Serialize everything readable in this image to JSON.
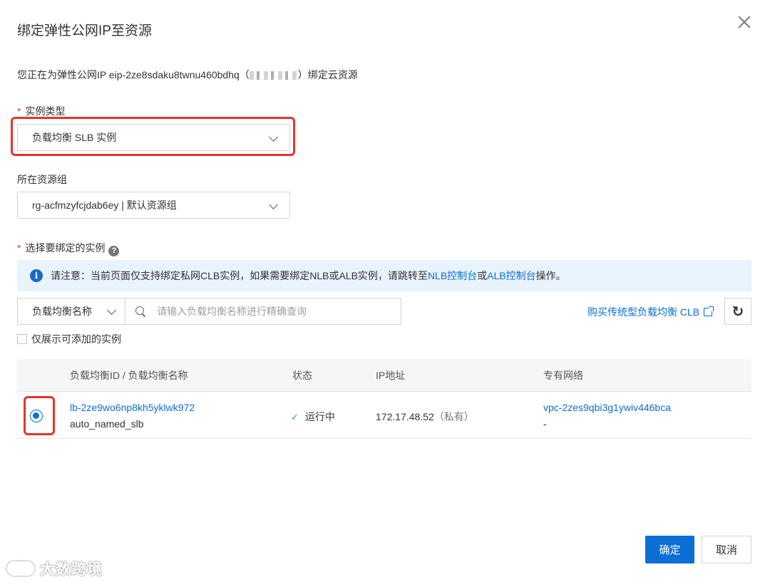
{
  "dialog": {
    "title": "绑定弹性公网IP至资源",
    "intro_prefix": "您正在为弹性公网IP eip-2ze8sdaku8twnu460bdhq（",
    "intro_suffix": "）绑定云资源"
  },
  "instance_type": {
    "label": "实例类型",
    "required_mark": "*",
    "value": "负载均衡 SLB 实例"
  },
  "resource_group": {
    "label": "所在资源组",
    "value": "rg-acfmzyfcjdab6ey | 默认资源组"
  },
  "select_instance": {
    "label": "选择要绑定的实例",
    "required_mark": "*",
    "help_icon": "question-circle-icon"
  },
  "notice": {
    "icon": "info-icon",
    "text_prefix": "请注意：当前页面仅支持绑定私网CLB实例，如果需要绑定NLB或ALB实例，请跳转至",
    "nlb_link": "NLB控制台",
    "middle": "或",
    "alb_link": "ALB控制台",
    "suffix": "操作。"
  },
  "filter": {
    "field_select": "负载均衡名称",
    "search_placeholder": "请输入负载均衡名称进行精确查询",
    "buy_link": "购买传统型负载均衡 CLB",
    "only_addable_label": "仅展示可添加的实例"
  },
  "table": {
    "columns": [
      "负载均衡ID / 负载均衡名称",
      "状态",
      "IP地址",
      "专有网络"
    ],
    "rows": [
      {
        "id": "lb-2ze9wo6np8kh5yklwk972",
        "name": "auto_named_slb",
        "status": "运行中",
        "ip": "172.17.48.52",
        "ip_note": "（私有）",
        "vpc": "vpc-2zes9qbi3g1ywiv446bca",
        "vpc_sub": "-",
        "selected": true
      }
    ]
  },
  "footer": {
    "confirm": "确定",
    "cancel": "取消"
  },
  "watermark": "大数跨境",
  "colors": {
    "primary": "#0b6fd6",
    "highlight_frame": "#e8332a",
    "notice_bg": "#e8f3fd",
    "status_ok": "#3ba54a"
  }
}
